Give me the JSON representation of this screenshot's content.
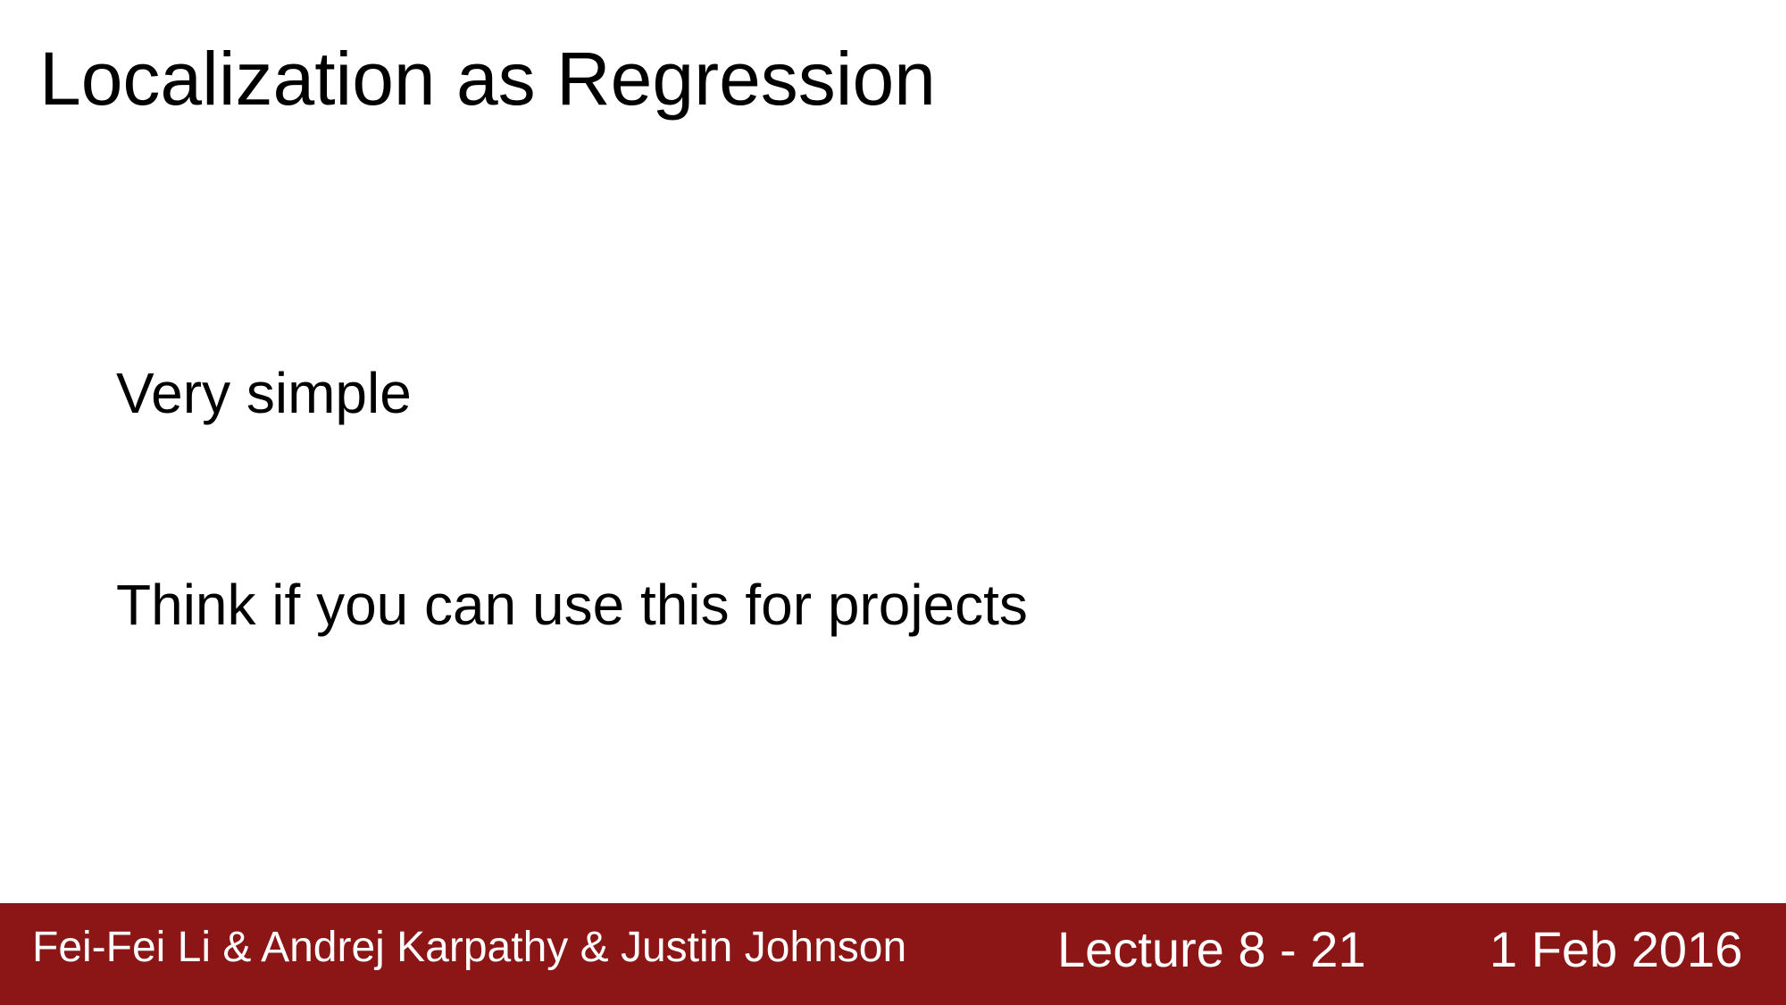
{
  "slide": {
    "title": "Localization as Regression",
    "body": [
      "Very simple",
      "Think if you can use this for projects"
    ]
  },
  "footer": {
    "authors": "Fei-Fei Li & Andrej Karpathy & Justin Johnson",
    "lecture": "Lecture 8 - 21",
    "date": "1 Feb 2016",
    "background_color": "#8c1515",
    "text_color": "#ffffff"
  }
}
